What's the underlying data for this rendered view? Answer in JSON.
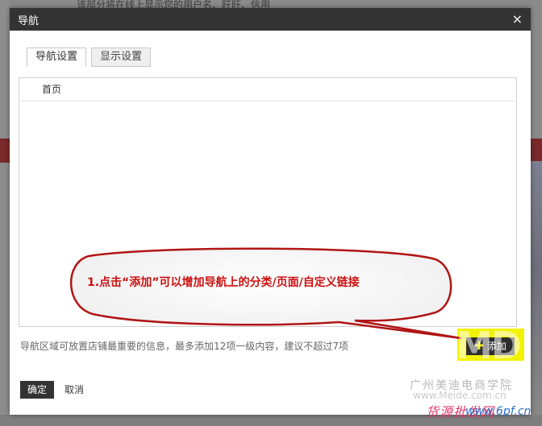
{
  "background": {
    "top_text": "该部分将在线上显示您的用户名、旺旺、信用"
  },
  "dialog": {
    "title": "导航",
    "close_glyph": "×",
    "tabs": [
      {
        "label": "导航设置",
        "active": true
      },
      {
        "label": "显示设置",
        "active": false
      }
    ],
    "nav_items": [
      "首页"
    ],
    "hint": "导航区域可放置店铺最重要的信息，最多添加12项一级内容，建议不超过7项",
    "add_button": {
      "label": "添加",
      "icon": "plus-icon"
    },
    "confirm_label": "确定",
    "cancel_label": "取消"
  },
  "annotation": {
    "callout_text": "1.点击“添加”可以增加导航上的分类/页面/自定义链接"
  },
  "watermark": {
    "company": "广州美迪电商学院",
    "url": "www.Meide.com.cn",
    "brand": "货源批发网",
    "domain": "www.6pf.cn"
  },
  "colors": {
    "header_bg": "#333333",
    "callout_text": "#cc1010",
    "highlight": "#f2f200"
  }
}
